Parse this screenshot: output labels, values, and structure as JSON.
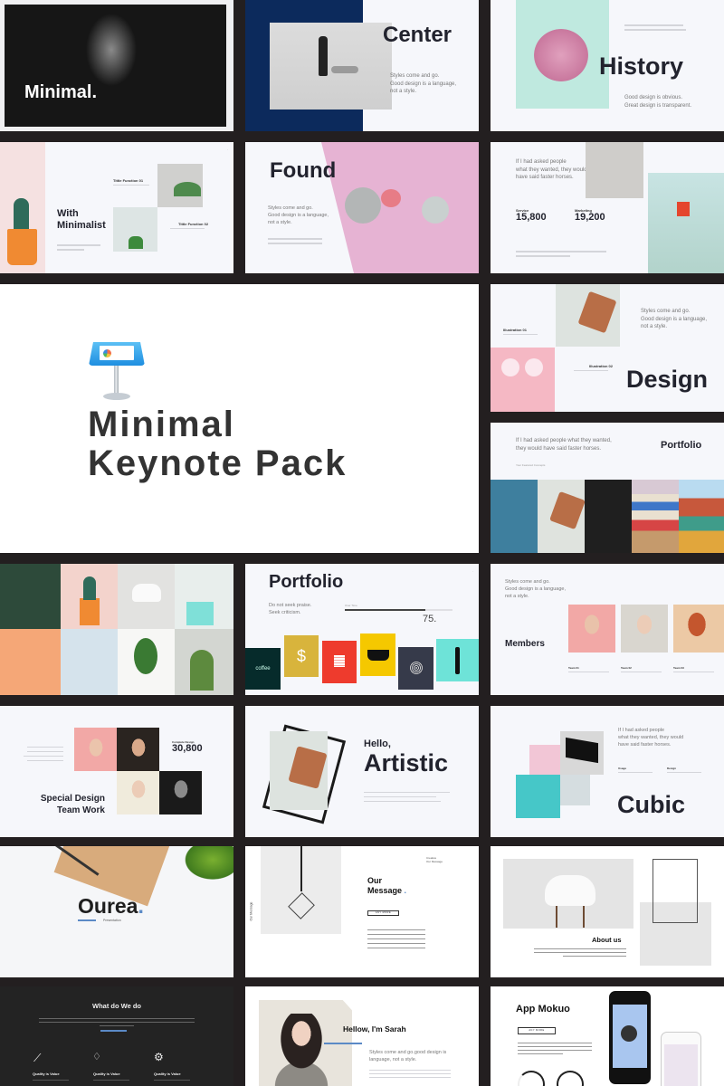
{
  "background_color": "#231f20",
  "accent_color": "#5b8ac6",
  "hero": {
    "icon": "keynote-icon",
    "title_line1": "Minimal",
    "title_line2": "Keynote Pack"
  },
  "slides": {
    "minimal": {
      "title": "Minimal."
    },
    "center": {
      "title": "Center",
      "body": [
        "Styles come and go.",
        "Good design is a language,",
        "not a style."
      ]
    },
    "history": {
      "title": "History",
      "quote": [
        "Good design is obvious.",
        "Great design is transparent."
      ]
    },
    "with_minimalist": {
      "title_line1": "With",
      "title_line2": "Minimalist",
      "label1": "Tittle Function 01",
      "label2": "Tittle Function 02"
    },
    "found": {
      "title": "Found",
      "body": [
        "Styles come and go.",
        "Good design is a language,",
        "not a style."
      ]
    },
    "stats": {
      "quote": [
        "If I had asked people",
        "what they wanted, they would",
        "have said faster horses."
      ],
      "stat1_label": "Service",
      "stat1_value": "15,800",
      "stat2_label": "Marketing",
      "stat2_value": "19,200"
    },
    "design": {
      "title": "Design",
      "label1": "Illustration 01",
      "label2": "Illustration 02",
      "quote": [
        "Styles come and go.",
        "Good design is a language,",
        "not a style."
      ]
    },
    "portfolio_strip": {
      "title": "Portfolio",
      "quote": [
        "If I had asked people what they wanted,",
        "they would have said faster horses."
      ],
      "caption": "Your Featured Concepts"
    },
    "portfolio_tiles": {
      "title": "Portfolio",
      "quote": [
        "Do not seek praise.",
        "Seek criticism."
      ],
      "progress_label": "Over Time",
      "progress_percent": 75,
      "progress_value": "75.",
      "tile_coffee": "coffee",
      "tile_dollar": "$"
    },
    "members": {
      "title": "Members",
      "quote": [
        "Styles come and go.",
        "Good design is a language,",
        "not a style."
      ],
      "teams": [
        "Team 01",
        "Team 02",
        "Team 03"
      ]
    },
    "team_work": {
      "title_line1": "Special Design",
      "title_line2": "Team Work",
      "stat_label": "Complete Design",
      "stat_value": "30,800"
    },
    "artistic": {
      "greeting": "Hello,",
      "title": "Artistic"
    },
    "cubic": {
      "title": "Cubic",
      "quote": [
        "If I had asked people",
        "what they wanted, they would",
        "have said faster horses."
      ],
      "label1": "Usage",
      "label2": "Design"
    },
    "ourea": {
      "title": "Ourea",
      "subtitle": "Presentation"
    },
    "our_message": {
      "title_line1": "Our",
      "title_line2": "Message",
      "button": "ANY MORE",
      "side_label": "Our Message",
      "corner": [
        "Creative",
        "Our Message"
      ]
    },
    "about": {
      "title": "About us"
    },
    "what_we_do": {
      "title": "What do We do",
      "items": [
        "Quality is Value",
        "Quality is Value",
        "Quality is Value"
      ]
    },
    "sarah": {
      "title": "Hellow, I'm Sarah",
      "quote": [
        "Styles come and go.good design is",
        "language, not a style."
      ]
    },
    "app": {
      "title": "App Mokuo",
      "button": "ANY MORE"
    }
  }
}
